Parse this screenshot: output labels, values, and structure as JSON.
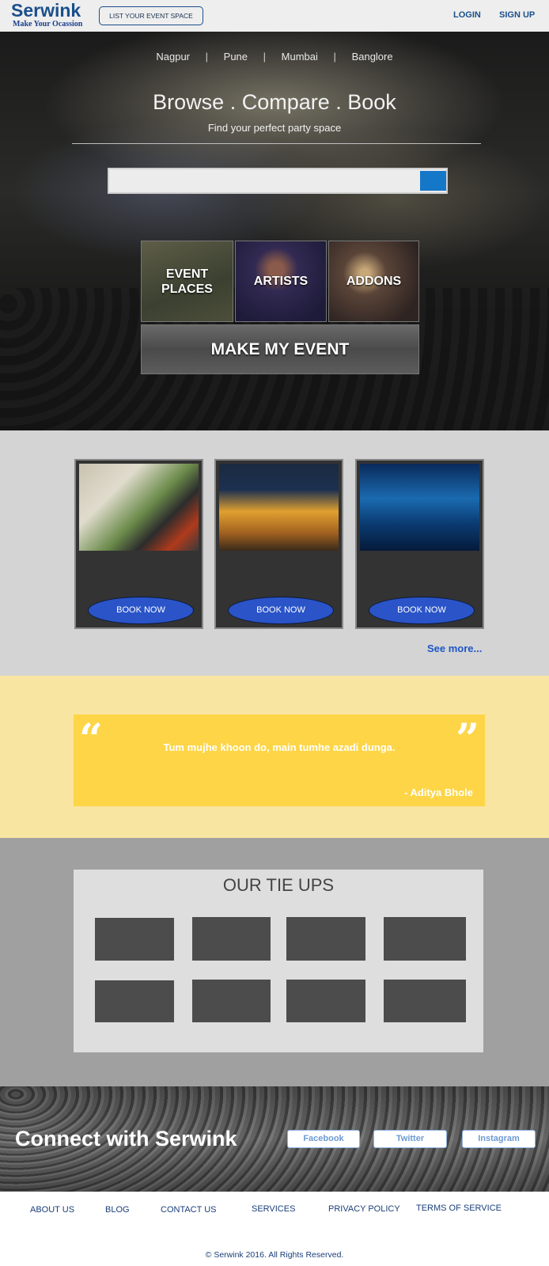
{
  "header": {
    "logo_name": "Serwink",
    "logo_tagline": "Make Your Ocassion",
    "list_button": "LIST YOUR EVENT SPACE",
    "login": "LOGIN",
    "signup": "SIGN UP"
  },
  "hero": {
    "cities": [
      "Nagpur",
      "Pune",
      "Mumbai",
      "Banglore"
    ],
    "separator": "|",
    "title": "Browse . Compare . Book",
    "subtitle": "Find your perfect party space",
    "search_placeholder": "",
    "tiles": {
      "event_places_line1": "EVENT",
      "event_places_line2": "PLACES",
      "artists": "ARTISTS",
      "addons": "ADDONS",
      "make_my_event": "MAKE MY EVENT"
    }
  },
  "venues": {
    "cards": [
      {
        "button": "BOOK NOW"
      },
      {
        "button": "BOOK NOW"
      },
      {
        "button": "BOOK NOW"
      }
    ],
    "see_more": "See more..."
  },
  "quote": {
    "open_mark": "“",
    "close_mark": "”",
    "text": "Tum mujhe khoon do, main tumhe azadi dunga.",
    "author": "- Aditya Bhole"
  },
  "tieups": {
    "title": "OUR TIE UPS"
  },
  "connect": {
    "title": "Connect with Serwink",
    "facebook": "Facebook",
    "twitter": "Twitter",
    "instagram": "Instagram"
  },
  "footer": {
    "links": [
      "ABOUT US",
      "BLOG",
      "CONTACT US",
      "SERVICES",
      "PRIVACY POLICY",
      "TERMS OF SERVICE"
    ],
    "copyright": "© Serwink 2016. All Rights Reserved."
  },
  "colors": {
    "brand_blue": "#1a4f8b",
    "button_blue": "#2a54c8",
    "search_button": "#1577c8",
    "quote_yellow": "#fdd546"
  }
}
